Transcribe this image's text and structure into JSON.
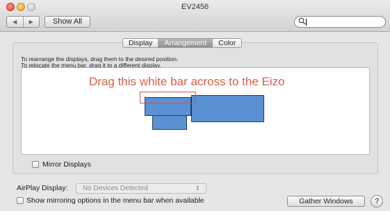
{
  "window": {
    "title": "EV2456"
  },
  "toolbar": {
    "back_glyph": "◀",
    "forward_glyph": "▶",
    "show_all_label": "Show All",
    "search_icon": "search-icon",
    "search_value": ""
  },
  "tabs": [
    {
      "label": "Display",
      "selected": false
    },
    {
      "label": "Arrangement",
      "selected": true
    },
    {
      "label": "Color",
      "selected": false
    }
  ],
  "arrangement": {
    "instruction_line1": "To rearrange the displays, drag them to the desired position.",
    "instruction_line2": "To relocate the menu bar, drag it to a different display.",
    "annotation": "Drag this white bar across to the Eizo",
    "annotation_color": "#dc5d4a",
    "display_color": "#5b91d3"
  },
  "mirror_displays": {
    "label": "Mirror Displays",
    "checked": false
  },
  "airplay": {
    "label": "AirPlay Display:",
    "value": "No Devices Detected",
    "arrow": "⇕"
  },
  "mirroring_option": {
    "label": "Show mirroring options in the menu bar when available",
    "checked": false
  },
  "buttons": {
    "gather_windows": "Gather Windows",
    "help": "?"
  }
}
